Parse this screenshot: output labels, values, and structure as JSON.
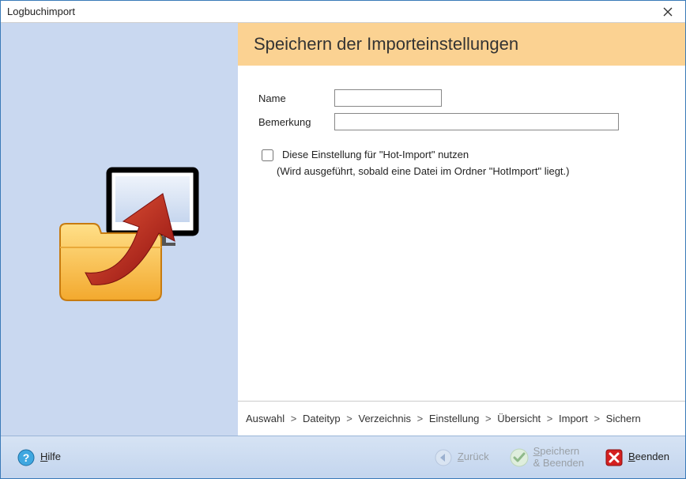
{
  "window": {
    "title": "Logbuchimport"
  },
  "header": {
    "title": "Speichern der Importeinstellungen"
  },
  "form": {
    "name_label": "Name",
    "name_value": "",
    "remark_label": "Bemerkung",
    "remark_value": "",
    "hotimport_checked": false,
    "hotimport_label": "Diese Einstellung für \"Hot-Import\" nutzen",
    "hotimport_sub": "(Wird ausgeführt, sobald eine Datei im Ordner \"HotImport\" liegt.)"
  },
  "breadcrumb": {
    "items": [
      "Auswahl",
      "Dateityp",
      "Verzeichnis",
      "Einstellung",
      "Übersicht",
      "Import",
      "Sichern"
    ],
    "sep": ">"
  },
  "footer": {
    "help": "Hilfe",
    "back": "Zurück",
    "save_line1": "Speichern",
    "save_line2": "& Beenden",
    "exit": "Beenden"
  }
}
